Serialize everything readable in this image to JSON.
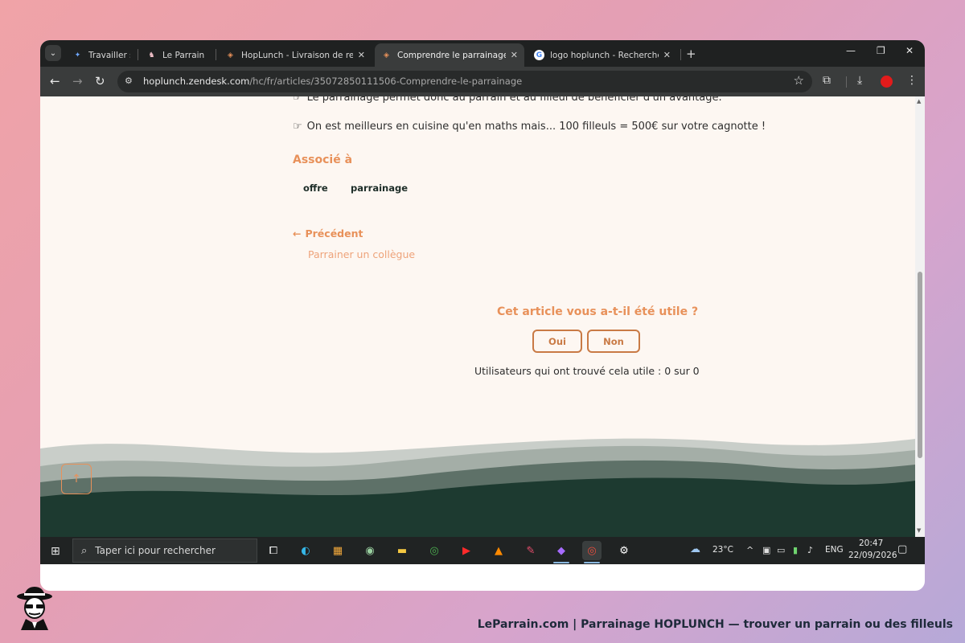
{
  "browser": {
    "tabs": [
      {
        "label": "Travailler sur l",
        "favicon": "gemini-icon"
      },
      {
        "label": "Le Parrain - Le",
        "favicon": "leparrain-icon"
      },
      {
        "label": "HopLunch - Livraison de repas e",
        "favicon": "hoplunch-icon"
      },
      {
        "label": "Comprendre le parrainage – Ho",
        "favicon": "hoplunch-icon",
        "active": true
      },
      {
        "label": "logo hoplunch - Recherche Goo",
        "favicon": "google-icon"
      }
    ],
    "url_host": "hoplunch.zendesk.com",
    "url_path": "/hc/fr/articles/35072850111506-Comprendre-le-parrainage"
  },
  "article": {
    "line_partial": "Le parrainage permet donc au parrain et au filleul de bénéficier d'un avantage.",
    "line_math": "On est meilleurs en cuisine qu'en maths mais... 100 filleuls = 500€ sur votre cagnotte !",
    "related_title": "Associé à",
    "tags": [
      "offre",
      "parrainage"
    ],
    "prev_label": "Précédent",
    "prev_title": "Parrainer un collègue"
  },
  "feedback": {
    "question": "Cet article vous a-t-il été utile ?",
    "yes": "Oui",
    "no": "Non",
    "count": "Utilisateurs qui ont trouvé cela utile : 0 sur 0"
  },
  "taskbar": {
    "search_placeholder": "Taper ici pour rechercher",
    "weather": "23°C",
    "lang": "ENG",
    "time": "20:47",
    "date": "22/09/2026"
  },
  "footer": {
    "text": "LeParrain.com | Parrainage HOPLUNCH — trouver un parrain ou des filleuls"
  },
  "colors": {
    "accent": "#e8915a",
    "button_border": "#c97a45",
    "wave_dark": "#1d3a30",
    "page_bg": "#fdf7f2"
  }
}
